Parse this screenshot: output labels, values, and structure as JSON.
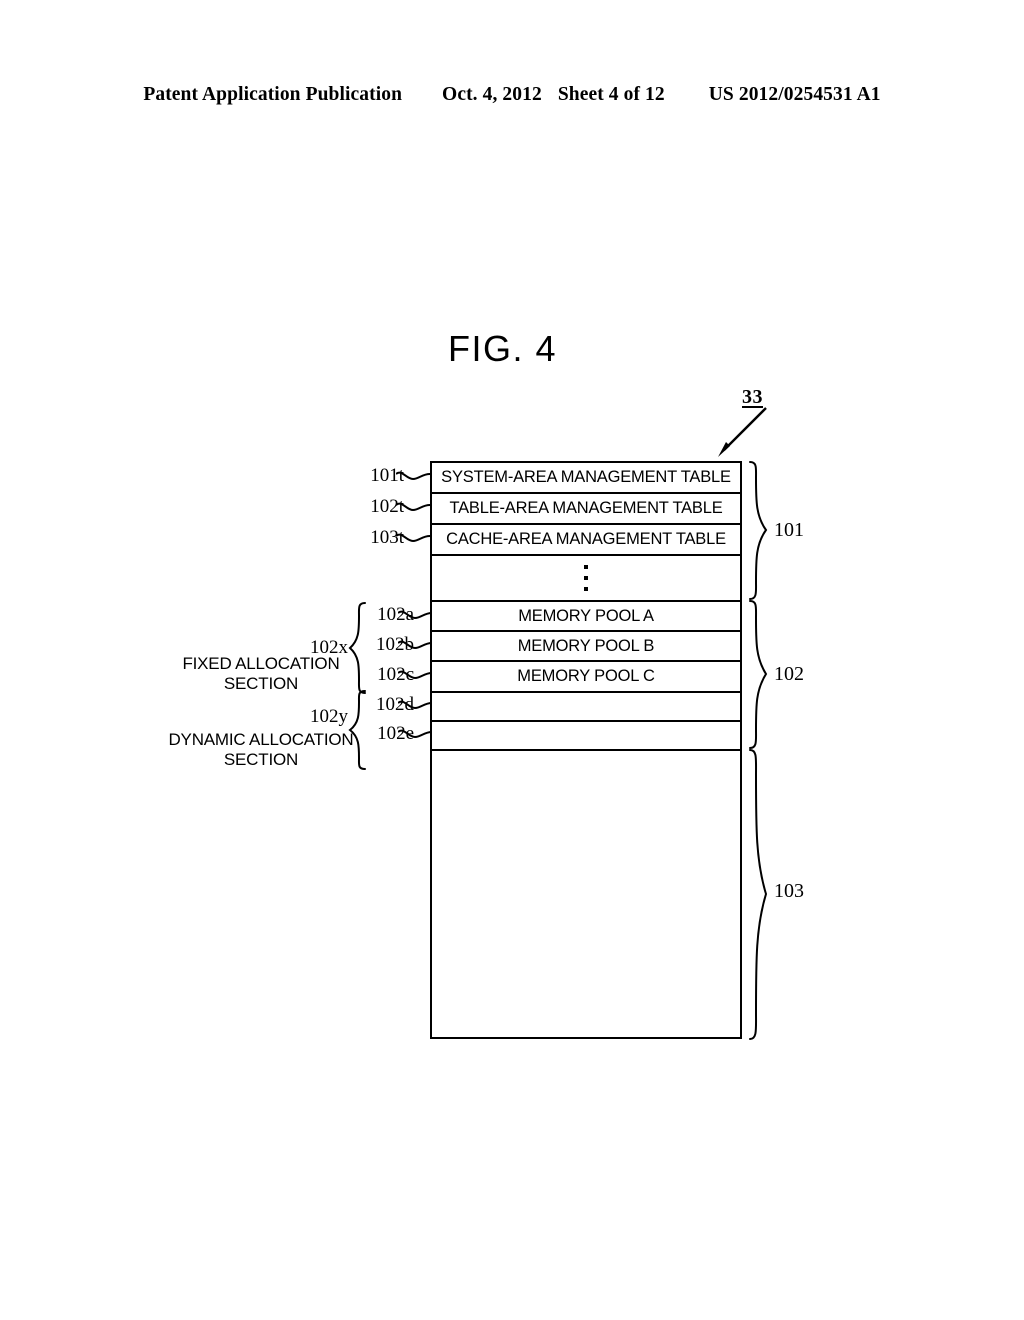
{
  "header": {
    "publication": "Patent Application Publication",
    "date": "Oct. 4, 2012",
    "sheet": "Sheet 4 of 12",
    "patent_number": "US 2012/0254531 A1"
  },
  "figure": {
    "title": "FIG. 4",
    "top_reference": "33"
  },
  "memory_map": {
    "rows": [
      {
        "ref": "101t",
        "label": "SYSTEM-AREA MANAGEMENT TABLE"
      },
      {
        "ref": "102t",
        "label": "TABLE-AREA MANAGEMENT TABLE"
      },
      {
        "ref": "103t",
        "label": "CACHE-AREA MANAGEMENT TABLE"
      },
      {
        "ref": "",
        "label": "⋮"
      },
      {
        "ref": "102a",
        "label": "MEMORY POOL A"
      },
      {
        "ref": "102b",
        "label": "MEMORY POOL B"
      },
      {
        "ref": "102c",
        "label": "MEMORY POOL C"
      },
      {
        "ref": "102d",
        "label": ""
      },
      {
        "ref": "102e",
        "label": ""
      },
      {
        "ref": "",
        "label": ""
      }
    ]
  },
  "left_groups": [
    {
      "id": "102x",
      "name_line1": "FIXED ALLOCATION",
      "name_line2": "SECTION"
    },
    {
      "id": "102y",
      "name_line1": "DYNAMIC ALLOCATION",
      "name_line2": "SECTION"
    }
  ],
  "right_groups": [
    {
      "id": "101"
    },
    {
      "id": "102"
    },
    {
      "id": "103"
    }
  ],
  "colors": {
    "ink": "#000000",
    "paper": "#ffffff"
  }
}
